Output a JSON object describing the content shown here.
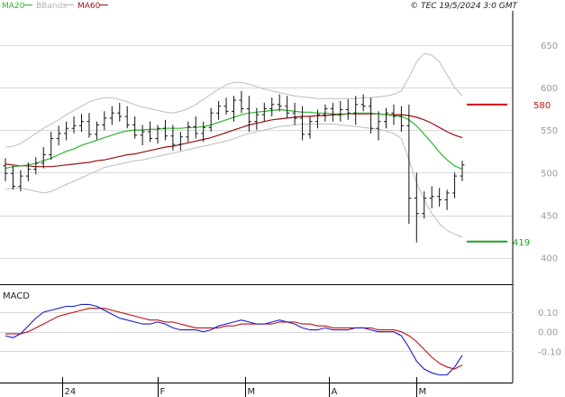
{
  "legend": [
    {
      "label": "MA20",
      "color": "#2db52d"
    },
    {
      "label": "BBands",
      "color": "#b5b5b5"
    },
    {
      "label": "MA60",
      "color": "#9a1010"
    }
  ],
  "timestamp": "© TEC 19/5/2024 3:0 GMT",
  "macd_panel_label": "MACD",
  "price_axis_labels": [
    "650",
    "600",
    "550",
    "500",
    "450",
    "400"
  ],
  "macd_axis_labels": [
    "0.10",
    "0.00",
    "-0.10"
  ],
  "x_axis_labels": [
    "24",
    "F",
    "M",
    "A",
    "M"
  ],
  "levels": {
    "resistance": {
      "label": "580",
      "color": "#d01010"
    },
    "support": {
      "label": "419",
      "color": "#20a020"
    }
  },
  "chart_data": {
    "type": "candlestick",
    "y_range": [
      370,
      690
    ],
    "ticks": [
      650,
      600,
      550,
      500,
      450,
      400
    ],
    "ohlc": [
      [
        508,
        517,
        490,
        499
      ],
      [
        499,
        508,
        480,
        484
      ],
      [
        484,
        503,
        478,
        496
      ],
      [
        496,
        512,
        490,
        504
      ],
      [
        504,
        518,
        498,
        511
      ],
      [
        511,
        530,
        505,
        521
      ],
      [
        521,
        548,
        515,
        540
      ],
      [
        540,
        555,
        532,
        546
      ],
      [
        546,
        560,
        538,
        552
      ],
      [
        552,
        566,
        546,
        555
      ],
      [
        555,
        569,
        548,
        560
      ],
      [
        560,
        570,
        541,
        545
      ],
      [
        545,
        560,
        539,
        556
      ],
      [
        556,
        572,
        550,
        564
      ],
      [
        564,
        578,
        556,
        570
      ],
      [
        570,
        582,
        560,
        566
      ],
      [
        566,
        578,
        552,
        556
      ],
      [
        556,
        566,
        540,
        544
      ],
      [
        544,
        556,
        532,
        548
      ],
      [
        548,
        560,
        536,
        540
      ],
      [
        540,
        556,
        534,
        552
      ],
      [
        552,
        562,
        538,
        543
      ],
      [
        543,
        556,
        526,
        533
      ],
      [
        533,
        548,
        526,
        542
      ],
      [
        542,
        560,
        536,
        554
      ],
      [
        554,
        566,
        540,
        546
      ],
      [
        546,
        560,
        536,
        553
      ],
      [
        553,
        576,
        548,
        570
      ],
      [
        570,
        584,
        562,
        578
      ],
      [
        578,
        588,
        568,
        572
      ],
      [
        572,
        590,
        560,
        585
      ],
      [
        585,
        596,
        570,
        575
      ],
      [
        575,
        590,
        548,
        560
      ],
      [
        560,
        576,
        550,
        568
      ],
      [
        568,
        582,
        560,
        575
      ],
      [
        575,
        588,
        566,
        580
      ],
      [
        580,
        592,
        572,
        578
      ],
      [
        578,
        590,
        564,
        570
      ],
      [
        570,
        582,
        556,
        564
      ],
      [
        564,
        578,
        538,
        545
      ],
      [
        545,
        566,
        540,
        560
      ],
      [
        560,
        574,
        552,
        568
      ],
      [
        568,
        580,
        560,
        575
      ],
      [
        575,
        582,
        560,
        568
      ],
      [
        568,
        584,
        560,
        574
      ],
      [
        574,
        586,
        562,
        570
      ],
      [
        570,
        590,
        556,
        580
      ],
      [
        580,
        592,
        572,
        578
      ],
      [
        578,
        588,
        546,
        552
      ],
      [
        552,
        572,
        538,
        560
      ],
      [
        560,
        576,
        552,
        570
      ],
      [
        570,
        580,
        556,
        566
      ],
      [
        566,
        578,
        548,
        555
      ],
      [
        555,
        580,
        440,
        470
      ],
      [
        470,
        500,
        418,
        452
      ],
      [
        452,
        478,
        446,
        470
      ],
      [
        470,
        484,
        458,
        472
      ],
      [
        472,
        482,
        460,
        468
      ],
      [
        468,
        480,
        456,
        476
      ],
      [
        476,
        500,
        470,
        496
      ],
      [
        496,
        514,
        490,
        509
      ]
    ],
    "ma20": [
      505,
      507,
      508,
      509,
      511,
      514,
      517,
      521,
      525,
      528,
      532,
      535,
      538,
      541,
      544,
      547,
      549,
      550,
      550,
      551,
      551,
      552,
      552,
      552,
      553,
      553,
      554,
      556,
      559,
      562,
      565,
      568,
      570,
      571,
      572,
      573,
      574,
      573,
      572,
      571,
      571,
      570,
      570,
      569,
      569,
      569,
      570,
      570,
      570,
      569,
      568,
      567,
      566,
      562,
      555,
      545,
      535,
      524,
      515,
      508,
      504
    ],
    "ma60": [
      510,
      509,
      508,
      508,
      507,
      507,
      507,
      508,
      509,
      510,
      511,
      512,
      514,
      515,
      517,
      519,
      521,
      522,
      524,
      526,
      528,
      530,
      531,
      533,
      535,
      537,
      539,
      541,
      544,
      547,
      550,
      553,
      556,
      558,
      560,
      562,
      563,
      564,
      565,
      566,
      566,
      567,
      567,
      568,
      568,
      569,
      569,
      569,
      569,
      569,
      568,
      568,
      568,
      567,
      565,
      562,
      558,
      553,
      548,
      544,
      541
    ],
    "bb_upper": [
      530,
      531,
      534,
      540,
      546,
      552,
      557,
      562,
      568,
      573,
      578,
      583,
      586,
      588,
      588,
      586,
      583,
      580,
      577,
      575,
      573,
      571,
      570,
      572,
      575,
      580,
      586,
      592,
      598,
      603,
      606,
      606,
      604,
      601,
      598,
      596,
      594,
      592,
      590,
      589,
      588,
      587,
      587,
      587,
      587,
      587,
      587,
      588,
      588,
      589,
      590,
      592,
      596,
      612,
      630,
      640,
      638,
      630,
      615,
      600,
      590
    ],
    "bb_lower": [
      480,
      482,
      482,
      480,
      478,
      476,
      478,
      482,
      486,
      490,
      494,
      498,
      502,
      506,
      508,
      510,
      512,
      514,
      515,
      517,
      519,
      521,
      523,
      525,
      527,
      529,
      531,
      533,
      535,
      537,
      540,
      543,
      546,
      548,
      550,
      552,
      554,
      555,
      556,
      557,
      557,
      557,
      557,
      557,
      556,
      555,
      554,
      553,
      552,
      551,
      549,
      546,
      540,
      515,
      488,
      468,
      452,
      440,
      432,
      428,
      424
    ],
    "macd_range": [
      -0.25,
      0.22
    ],
    "macd_ticks": [
      0.1,
      0.0,
      -0.1
    ],
    "macd": [
      -0.02,
      -0.03,
      -0.01,
      0.03,
      0.07,
      0.1,
      0.11,
      0.12,
      0.13,
      0.13,
      0.14,
      0.14,
      0.13,
      0.11,
      0.09,
      0.07,
      0.06,
      0.05,
      0.04,
      0.04,
      0.05,
      0.04,
      0.02,
      0.01,
      0.01,
      0.01,
      0.0,
      0.01,
      0.03,
      0.04,
      0.05,
      0.06,
      0.05,
      0.04,
      0.04,
      0.05,
      0.06,
      0.05,
      0.04,
      0.02,
      0.01,
      0.01,
      0.02,
      0.01,
      0.01,
      0.01,
      0.02,
      0.02,
      0.01,
      0.0,
      0.0,
      0.0,
      -0.02,
      -0.08,
      -0.15,
      -0.19,
      -0.21,
      -0.22,
      -0.22,
      -0.18,
      -0.12
    ],
    "signal": [
      -0.01,
      -0.01,
      -0.01,
      0.0,
      0.02,
      0.04,
      0.06,
      0.08,
      0.09,
      0.1,
      0.11,
      0.12,
      0.12,
      0.12,
      0.11,
      0.1,
      0.09,
      0.08,
      0.07,
      0.06,
      0.06,
      0.05,
      0.05,
      0.04,
      0.03,
      0.02,
      0.02,
      0.02,
      0.02,
      0.03,
      0.03,
      0.04,
      0.04,
      0.04,
      0.04,
      0.04,
      0.05,
      0.05,
      0.05,
      0.04,
      0.04,
      0.03,
      0.03,
      0.02,
      0.02,
      0.02,
      0.02,
      0.02,
      0.02,
      0.01,
      0.01,
      0.01,
      0.0,
      -0.02,
      -0.05,
      -0.09,
      -0.13,
      -0.16,
      -0.18,
      -0.19,
      -0.17
    ],
    "levels": {
      "resistance": 580,
      "support": 419
    }
  }
}
